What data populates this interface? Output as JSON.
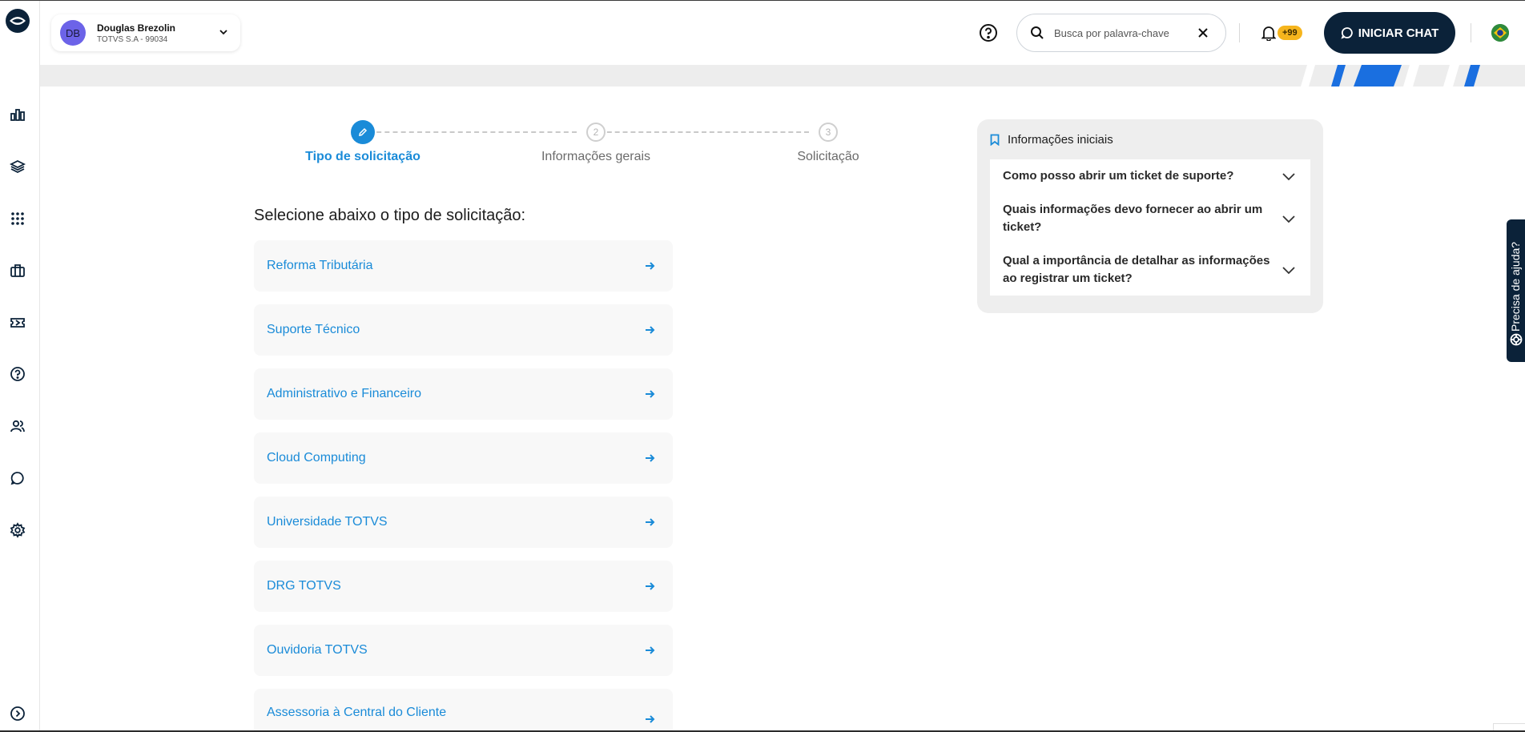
{
  "user": {
    "initials": "DB",
    "name": "Douglas Brezolin",
    "company": "TOTVS S.A - 99034"
  },
  "search": {
    "placeholder": "Busca por palavra-chave"
  },
  "notifications": {
    "count": "+99"
  },
  "chat_button": {
    "label": "INICIAR CHAT"
  },
  "stepper": {
    "steps": [
      {
        "label": "Tipo de solicitação",
        "number": "",
        "state": "active"
      },
      {
        "label": "Informações gerais",
        "number": "2",
        "state": "inactive"
      },
      {
        "label": "Solicitação",
        "number": "3",
        "state": "inactive"
      }
    ]
  },
  "main": {
    "section_title": "Selecione abaixo o tipo de solicitação:",
    "options": [
      "Reforma Tributária",
      "Suporte Técnico",
      "Administrativo e Financeiro",
      "Cloud Computing",
      "Universidade TOTVS",
      "DRG TOTVS",
      "Ouvidoria TOTVS",
      "Assessoria à Central do Cliente"
    ]
  },
  "faq": {
    "title": "Informações iniciais",
    "items": [
      "Como posso abrir um ticket de suporte?",
      "Quais informações devo fornecer ao abrir um ticket?",
      "Qual a importância de detalhar as informações ao registrar um ticket?"
    ]
  },
  "help_tab": {
    "label": "Precisa de ajuda?"
  },
  "colors": {
    "accent": "#1a8bd8",
    "navy": "#0b2239",
    "badge": "#f6b51d"
  }
}
